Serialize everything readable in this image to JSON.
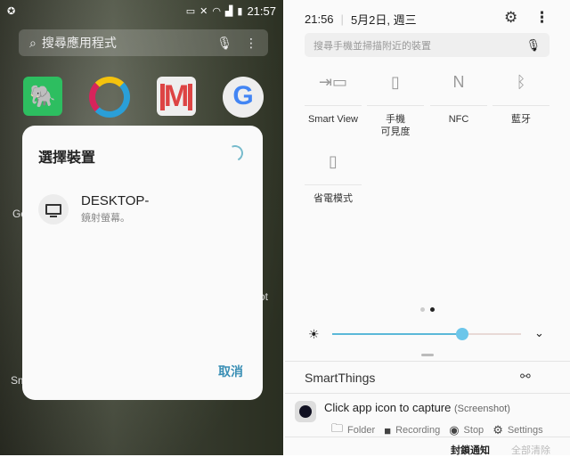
{
  "left": {
    "status_bar": {
      "time": "21:57"
    },
    "app_search": {
      "placeholder": "搜尋應用程式"
    },
    "apps": [
      "evernote",
      "ring-app",
      "gmail",
      "google"
    ],
    "edge_labels": [
      "Go",
      "Sm",
      "ot"
    ],
    "dialog": {
      "title": "選擇裝置",
      "device": {
        "name": "DESKTOP-",
        "subtitle": "鏡射螢幕。"
      },
      "cancel_label": "取消"
    }
  },
  "right": {
    "header": {
      "time": "21:56",
      "date": "5月2日, 週三"
    },
    "search": {
      "placeholder": "搜尋手機並掃描附近的裝置"
    },
    "tiles": [
      {
        "label": "Smart View",
        "icon": "smart-view-icon"
      },
      {
        "label": "手機\n可見度",
        "icon": "phone-visibility-icon"
      },
      {
        "label": "NFC",
        "icon": "nfc-icon"
      },
      {
        "label": "藍牙",
        "icon": "bluetooth-icon"
      },
      {
        "label": "省電模式",
        "icon": "power-saving-icon"
      }
    ],
    "page_indicator": {
      "pages": 2,
      "current": 2
    },
    "brightness": {
      "value": 0.69,
      "accent": "#6cc6ea"
    },
    "smartthings": {
      "label": "SmartThings"
    },
    "notification": {
      "title": "Click app icon to capture",
      "app": "(Screenshot)",
      "actions": [
        "Folder",
        "Recording",
        "Stop",
        "Settings"
      ]
    },
    "footer": {
      "block": "封鎖通知",
      "clear": "全部清除"
    }
  }
}
